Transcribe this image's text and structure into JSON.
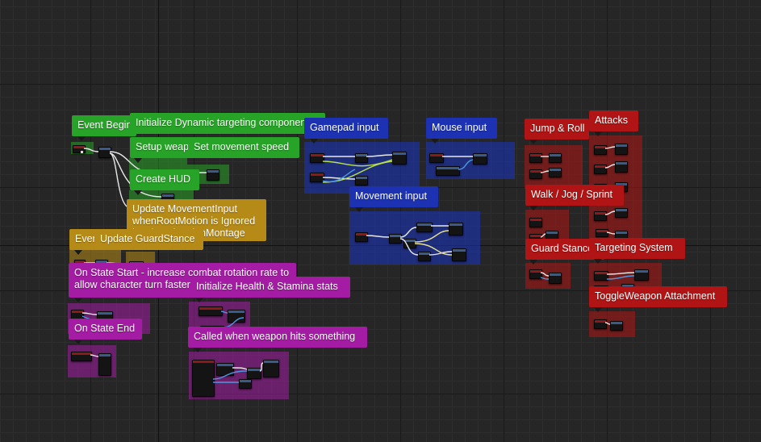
{
  "editor": {
    "type": "blueprint-event-graph",
    "grid_visible": true
  },
  "comments": [
    {
      "id": "event-begin-play",
      "label": "Event BeginPlay",
      "color": "#27a327"
    },
    {
      "id": "init-dynamic-targeting",
      "label": "Initialize Dynamic targeting component",
      "color": "#27a327"
    },
    {
      "id": "setup-weapon-collision",
      "label": "Setup weapon collision",
      "color": "#27a327"
    },
    {
      "id": "set-movement-speed",
      "label": "Set movement speed",
      "color": "#27a327"
    },
    {
      "id": "create-hud",
      "label": "Create HUD",
      "color": "#27a327"
    },
    {
      "id": "update-movement-input",
      "label": "Update MovementInput whenRootMotion is Ignored by played ActionMontage",
      "color": "#b58a16"
    },
    {
      "id": "event-tick",
      "label": "Event Tick",
      "color": "#b58a16"
    },
    {
      "id": "update-guard-stance",
      "label": "Update GuardStance",
      "color": "#b58a16"
    },
    {
      "id": "gamepad-input",
      "label": "Gamepad input",
      "color": "#1c32b3"
    },
    {
      "id": "mouse-input",
      "label": "Mouse input",
      "color": "#1c32b3"
    },
    {
      "id": "movement-input",
      "label": "Movement input",
      "color": "#1c32b3"
    },
    {
      "id": "on-state-start",
      "label": "On State Start - increase combat rotation rate to allow character turn faster",
      "color": "#a31ca3"
    },
    {
      "id": "init-health-stamina",
      "label": "Initialize Health & Stamina stats",
      "color": "#a31ca3"
    },
    {
      "id": "on-state-end",
      "label": "On State End",
      "color": "#a31ca3"
    },
    {
      "id": "weapon-hits",
      "label": "Called when weapon hits something",
      "color": "#a31ca3"
    },
    {
      "id": "jump-roll",
      "label": "Jump & Roll",
      "color": "#b01414"
    },
    {
      "id": "attacks",
      "label": "Attacks",
      "color": "#b01414"
    },
    {
      "id": "walk-jog-sprint",
      "label": "Walk / Jog / Sprint",
      "color": "#b01414"
    },
    {
      "id": "guard-stance",
      "label": "Guard Stance",
      "color": "#b01414"
    },
    {
      "id": "targeting-system",
      "label": "Targeting System",
      "color": "#b01414"
    },
    {
      "id": "toggle-weapon-attachment",
      "label": "ToggleWeapon Attachment",
      "color": "#b01414"
    }
  ]
}
